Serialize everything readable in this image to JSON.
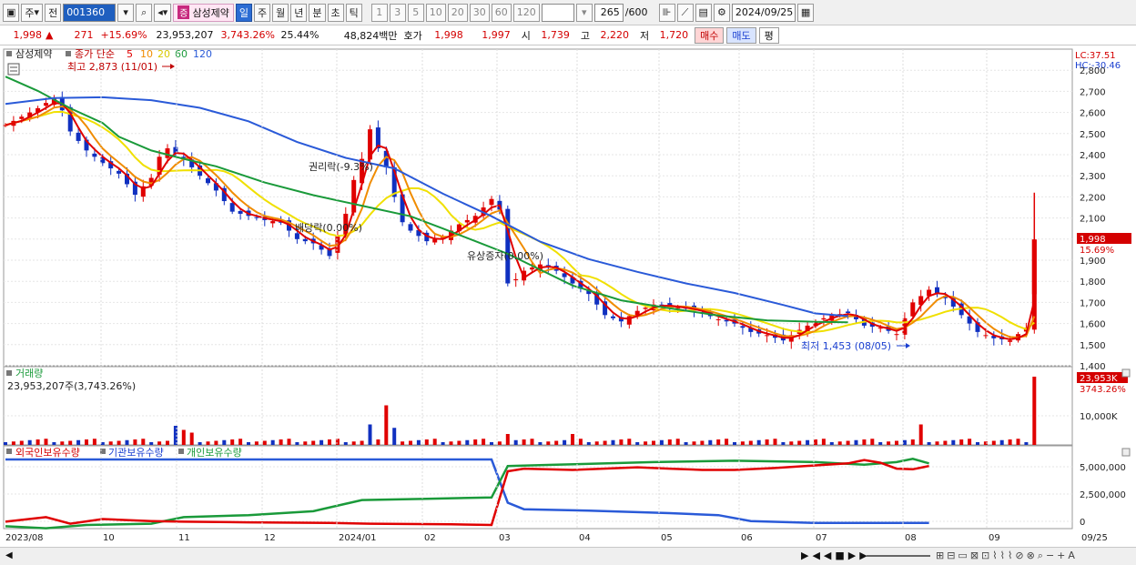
{
  "toolbar": {
    "market_label": "주",
    "prev_label": "전",
    "stock_code": "001360",
    "stock_name": "삼성제약",
    "jeung_badge": "증",
    "period_buttons": [
      "일",
      "주",
      "월",
      "년",
      "분",
      "초",
      "틱"
    ],
    "number_buttons": [
      "1",
      "3",
      "5",
      "10",
      "20",
      "30",
      "60",
      "120"
    ],
    "count": "265",
    "count_total": "/600",
    "date": "2024/09/25"
  },
  "quote": {
    "price": "1,998",
    "change": "271",
    "change_pct": "+15.69%",
    "volume": "23,953,207",
    "volume_pct": "3,743.26%",
    "turnover": "25.44%",
    "amount": "48,824백만",
    "hoga_label": "호가",
    "hoga_ask": "1,998",
    "hoga_bid": "1,997",
    "open_label": "시",
    "open": "1,739",
    "high_label": "고",
    "high": "2,220",
    "low_label": "저",
    "low": "1,720",
    "buy_label": "매수",
    "sell_label": "매도",
    "eval_label": "평"
  },
  "price_panel": {
    "stock_name": "삼성제약",
    "ma_legend_label": "종가 단순",
    "ma_periods": [
      "5",
      "10",
      "20",
      "60",
      "120"
    ],
    "high_annotation": "최고 2,873 (11/01)",
    "low_annotation": "최저 1,453 (08/05)",
    "event1": "권리락(-9.3%)",
    "event2": "배당락(0.00%)",
    "event3": "유상증자(0.00%)",
    "lc": "LC:37.51",
    "hc": "HC:-30.46",
    "current_price": "1,998",
    "current_pct": "15.69%",
    "y_ticks": [
      "2,800",
      "2,700",
      "2,600",
      "2,500",
      "2,400",
      "2,300",
      "2,200",
      "2,100",
      "2,000",
      "1,900",
      "1,800",
      "1,700",
      "1,600",
      "1,500",
      "1,400"
    ]
  },
  "volume_panel": {
    "title": "거래량",
    "value": "23,953,207주(3,743.26%)",
    "current": "23,953K",
    "current_pct": "3743.26%",
    "y_tick": "10,000K"
  },
  "holdings_panel": {
    "series": [
      "외국인보유수량",
      "기관보유수량",
      "개인보유수량"
    ],
    "y_ticks": [
      "5,000,000",
      "2,500,000",
      "0"
    ]
  },
  "x_axis": {
    "labels": [
      "2023/08",
      "10",
      "11",
      "12",
      "2024/01",
      "02",
      "03",
      "04",
      "05",
      "06",
      "07",
      "08",
      "09",
      "09/25"
    ]
  },
  "colors": {
    "up": "#e00000",
    "down": "#1030c0",
    "ma5": "#e00000",
    "ma10": "#f08c00",
    "ma20": "#f0e000",
    "ma60": "#1a9a3a",
    "ma120": "#2a5ad8"
  },
  "chart_data": {
    "type": "candlestick",
    "ylim": [
      1400,
      2900
    ],
    "ma120": [
      [
        0,
        2640
      ],
      [
        6,
        2668
      ],
      [
        12,
        2672
      ],
      [
        18,
        2658
      ],
      [
        24,
        2622
      ],
      [
        30,
        2558
      ],
      [
        36,
        2460
      ],
      [
        42,
        2385
      ],
      [
        48,
        2335
      ],
      [
        54,
        2215
      ],
      [
        60,
        2108
      ],
      [
        66,
        1988
      ],
      [
        72,
        1905
      ],
      [
        78,
        1845
      ],
      [
        84,
        1790
      ],
      [
        90,
        1745
      ],
      [
        96,
        1688
      ],
      [
        100,
        1648
      ],
      [
        104,
        1635
      ]
    ],
    "ma60": [
      [
        0,
        2770
      ],
      [
        4,
        2702
      ],
      [
        8,
        2620
      ],
      [
        12,
        2550
      ],
      [
        14,
        2485
      ],
      [
        18,
        2420
      ],
      [
        22,
        2380
      ],
      [
        26,
        2345
      ],
      [
        32,
        2268
      ],
      [
        38,
        2208
      ],
      [
        44,
        2158
      ],
      [
        50,
        2108
      ],
      [
        54,
        2050
      ],
      [
        58,
        1990
      ],
      [
        62,
        1930
      ],
      [
        66,
        1855
      ],
      [
        70,
        1780
      ],
      [
        76,
        1710
      ],
      [
        82,
        1672
      ],
      [
        88,
        1638
      ],
      [
        94,
        1615
      ],
      [
        100,
        1608
      ],
      [
        104,
        1606
      ]
    ],
    "closes": [
      [
        0,
        2540
      ],
      [
        2,
        2580
      ],
      [
        4,
        2620
      ],
      [
        6,
        2670
      ],
      [
        7,
        2610
      ],
      [
        8,
        2510
      ],
      [
        10,
        2420
      ],
      [
        12,
        2360
      ],
      [
        14,
        2310
      ],
      [
        16,
        2210
      ],
      [
        18,
        2290
      ],
      [
        19,
        2390
      ],
      [
        20,
        2430
      ],
      [
        22,
        2380
      ],
      [
        24,
        2300
      ],
      [
        26,
        2230
      ],
      [
        28,
        2130
      ],
      [
        30,
        2110
      ],
      [
        32,
        2090
      ],
      [
        34,
        2080
      ],
      [
        36,
        2000
      ],
      [
        38,
        1980
      ],
      [
        40,
        1920
      ],
      [
        42,
        2120
      ],
      [
        43,
        2280
      ],
      [
        44,
        2380
      ],
      [
        45,
        2520
      ],
      [
        46,
        2430
      ],
      [
        47,
        2340
      ],
      [
        48,
        2200
      ],
      [
        49,
        2080
      ],
      [
        50,
        2040
      ],
      [
        52,
        1990
      ],
      [
        54,
        2010
      ],
      [
        56,
        2070
      ],
      [
        58,
        2110
      ],
      [
        60,
        2190
      ],
      [
        61,
        2140
      ],
      [
        62,
        1790
      ],
      [
        63,
        1810
      ],
      [
        64,
        1850
      ],
      [
        66,
        1880
      ],
      [
        68,
        1850
      ],
      [
        70,
        1790
      ],
      [
        72,
        1740
      ],
      [
        74,
        1640
      ],
      [
        76,
        1610
      ],
      [
        78,
        1660
      ],
      [
        80,
        1690
      ],
      [
        82,
        1680
      ],
      [
        84,
        1670
      ],
      [
        86,
        1650
      ],
      [
        88,
        1620
      ],
      [
        90,
        1600
      ],
      [
        92,
        1560
      ],
      [
        94,
        1545
      ],
      [
        96,
        1520
      ],
      [
        98,
        1570
      ],
      [
        100,
        1610
      ],
      [
        102,
        1640
      ],
      [
        104,
        1650
      ],
      [
        106,
        1590
      ],
      [
        108,
        1580
      ],
      [
        110,
        1550
      ],
      [
        112,
        1700
      ],
      [
        114,
        1760
      ],
      [
        116,
        1720
      ],
      [
        118,
        1640
      ],
      [
        120,
        1560
      ],
      [
        122,
        1530
      ],
      [
        124,
        1520
      ],
      [
        126,
        1580
      ],
      [
        127,
        1998
      ]
    ],
    "volume_spikes": [
      [
        21,
        28
      ],
      [
        22,
        22
      ],
      [
        23,
        18
      ],
      [
        45,
        30
      ],
      [
        47,
        58
      ],
      [
        48,
        25
      ],
      [
        62,
        16
      ],
      [
        70,
        16
      ],
      [
        113,
        30
      ],
      [
        127,
        100
      ]
    ],
    "foreign": [
      [
        0,
        0.05
      ],
      [
        5,
        0.12
      ],
      [
        8,
        0.02
      ],
      [
        12,
        0.09
      ],
      [
        18,
        0.06
      ],
      [
        22,
        0.05
      ],
      [
        30,
        0.04
      ],
      [
        40,
        0.03
      ],
      [
        45,
        0.02
      ],
      [
        55,
        0.01
      ],
      [
        60,
        0.0
      ],
      [
        62,
        0.82
      ],
      [
        64,
        0.86
      ],
      [
        70,
        0.84
      ],
      [
        78,
        0.88
      ],
      [
        82,
        0.86
      ],
      [
        86,
        0.84
      ],
      [
        90,
        0.84
      ],
      [
        95,
        0.87
      ],
      [
        100,
        0.91
      ],
      [
        104,
        0.94
      ],
      [
        106,
        0.99
      ],
      [
        108,
        0.95
      ],
      [
        110,
        0.86
      ],
      [
        112,
        0.85
      ],
      [
        114,
        0.9
      ]
    ],
    "institution": [
      [
        0,
        1.0
      ],
      [
        60,
        1.0
      ],
      [
        62,
        0.34
      ],
      [
        64,
        0.24
      ],
      [
        72,
        0.22
      ],
      [
        82,
        0.18
      ],
      [
        88,
        0.15
      ],
      [
        92,
        0.06
      ],
      [
        100,
        0.03
      ],
      [
        114,
        0.03
      ]
    ],
    "individual": [
      [
        0,
        -0.02
      ],
      [
        5,
        -0.05
      ],
      [
        10,
        0.0
      ],
      [
        18,
        0.02
      ],
      [
        22,
        0.12
      ],
      [
        30,
        0.15
      ],
      [
        38,
        0.21
      ],
      [
        44,
        0.38
      ],
      [
        52,
        0.4
      ],
      [
        60,
        0.42
      ],
      [
        62,
        0.9
      ],
      [
        68,
        0.92
      ],
      [
        80,
        0.96
      ],
      [
        90,
        0.98
      ],
      [
        100,
        0.96
      ],
      [
        106,
        0.92
      ],
      [
        110,
        0.96
      ],
      [
        112,
        1.01
      ],
      [
        114,
        0.94
      ]
    ]
  }
}
